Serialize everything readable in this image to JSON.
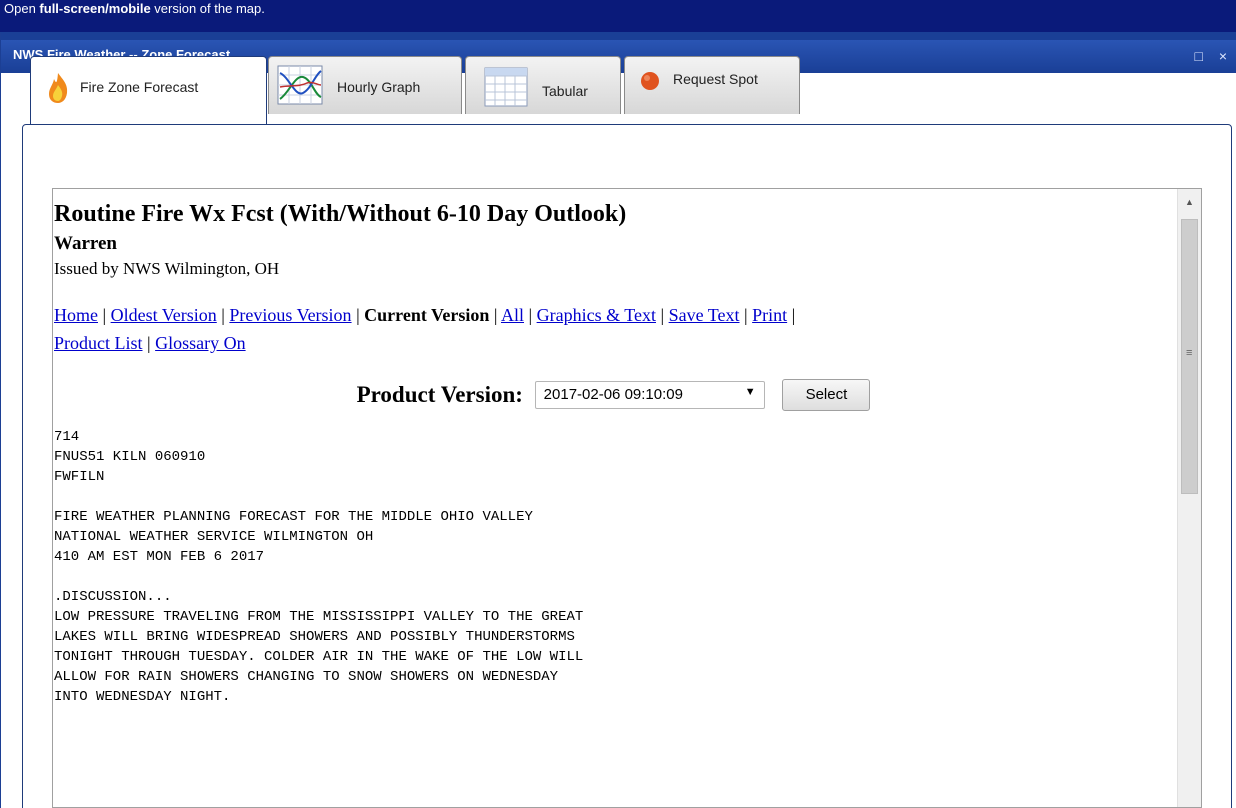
{
  "banner": {
    "pre": "Open ",
    "bold": "full-screen/mobile",
    "post": " version of the map."
  },
  "window": {
    "title": "NWS Fire Weather -- Zone Forecast",
    "restore_icon": "□",
    "close_icon": "×"
  },
  "tabs": [
    {
      "label": "Fire Zone Forecast",
      "icon": "fire-icon",
      "active": true
    },
    {
      "label": "Hourly Graph",
      "icon": "graph-icon",
      "active": false
    },
    {
      "label": "Tabular",
      "icon": "table-icon",
      "active": false
    },
    {
      "label": "Request Spot",
      "icon": "red-dot-icon",
      "active": false
    }
  ],
  "doc": {
    "title": "Routine Fire Wx Fcst (With/Without 6-10 Day Outlook)",
    "zone": "Warren",
    "issued": "Issued by NWS Wilmington, OH",
    "nav": {
      "home": "Home",
      "oldest": "Oldest Version",
      "previous": "Previous Version",
      "current": "Current Version",
      "all": "All",
      "graphics": "Graphics & Text",
      "save": "Save Text",
      "print": "Print",
      "product_list": "Product List",
      "glossary": "Glossary On",
      "sep": " | "
    },
    "version_label": "Product Version:",
    "version_value": "2017-02-06 09:10:09",
    "select_button": "Select",
    "text": "714\nFNUS51 KILN 060910\nFWFILN\n\nFIRE WEATHER PLANNING FORECAST FOR THE MIDDLE OHIO VALLEY\nNATIONAL WEATHER SERVICE WILMINGTON OH\n410 AM EST MON FEB 6 2017\n\n.DISCUSSION...\nLOW PRESSURE TRAVELING FROM THE MISSISSIPPI VALLEY TO THE GREAT\nLAKES WILL BRING WIDESPREAD SHOWERS AND POSSIBLY THUNDERSTORMS\nTONIGHT THROUGH TUESDAY. COLDER AIR IN THE WAKE OF THE LOW WILL\nALLOW FOR RAIN SHOWERS CHANGING TO SNOW SHOWERS ON WEDNESDAY\nINTO WEDNESDAY NIGHT."
  },
  "scrollbar": {
    "up_arrow": "▲",
    "grip": "≡"
  },
  "colors": {
    "banner": "#0a1a7a",
    "titlebar": "#1a3f96",
    "link": "#0000cc",
    "request_dot": "#e0531f"
  }
}
